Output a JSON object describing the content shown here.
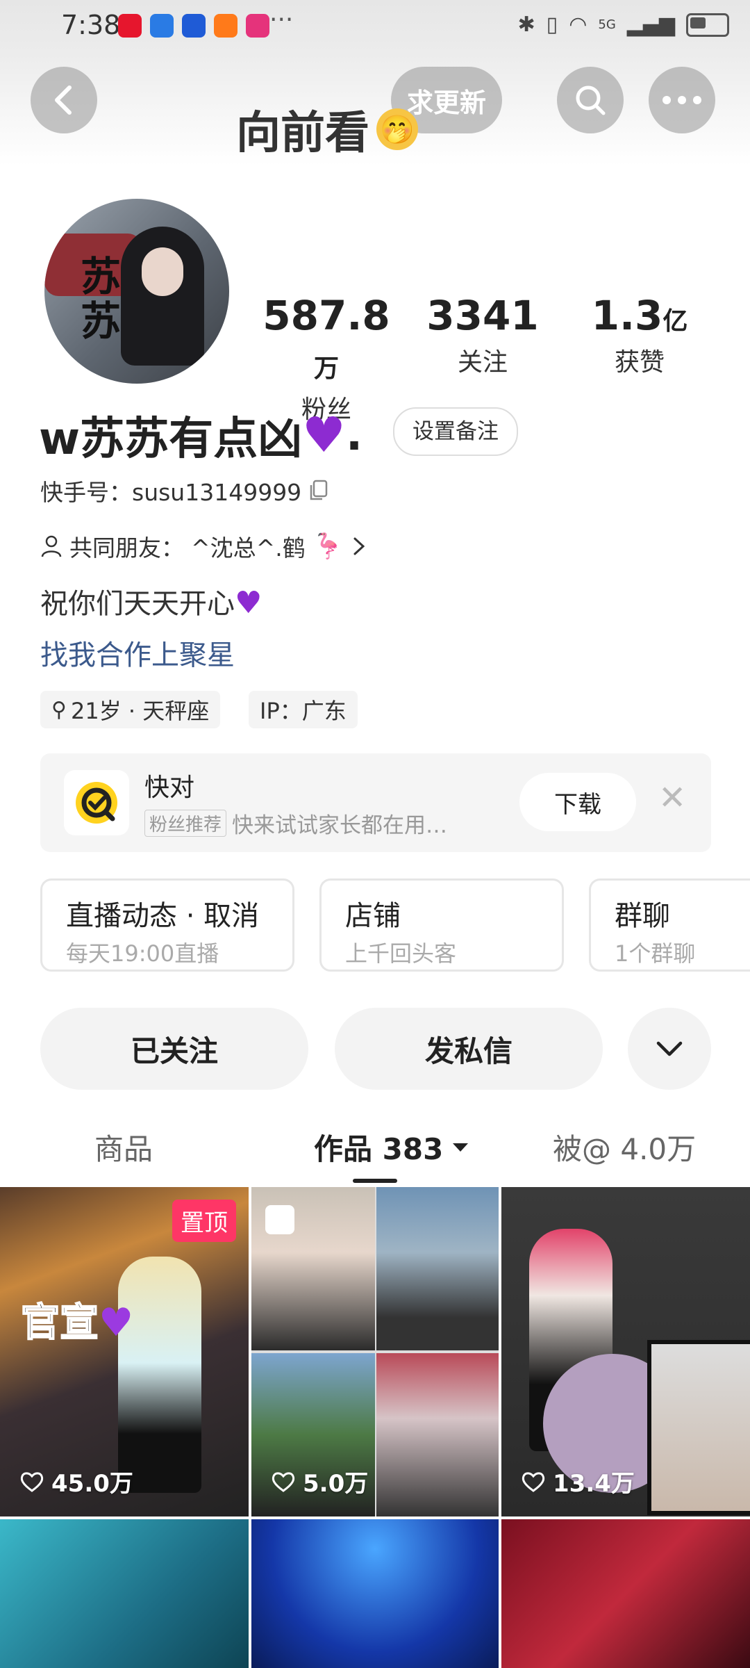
{
  "status_bar": {
    "time": "7:38",
    "more": "···",
    "network": "5G"
  },
  "header": {
    "title": "向前看",
    "update_label": "求更新"
  },
  "profile": {
    "name": "w苏苏有点凶",
    "name_suffix": ".",
    "avatar_text": "苏苏",
    "remark_label": "设置备注",
    "kuaishou_id": "快手号：susu13149999",
    "mutual_friends_label": "共同朋友：",
    "mutual_friends_value": "^沈总^.鹤",
    "bio": "祝你们天天开心",
    "link": "找我合作上聚星",
    "tags": [
      "21岁 · 天秤座",
      "IP：广东"
    ]
  },
  "stats": [
    {
      "value": "587.8",
      "unit": "万",
      "label": "粉丝"
    },
    {
      "value": "3341",
      "unit": "",
      "label": "关注"
    },
    {
      "value": "1.3",
      "unit": "亿",
      "label": "获赞"
    }
  ],
  "ad": {
    "title": "快对",
    "badge": "粉丝推荐",
    "subtitle": "快来试试家长都在用…",
    "download_label": "下载"
  },
  "features": [
    {
      "title": "直播动态 · 取消",
      "subtitle": "每天19:00直播"
    },
    {
      "title": "店铺",
      "subtitle": "上千回头客"
    },
    {
      "title": "群聊",
      "subtitle": "1个群聊"
    }
  ],
  "actions": {
    "follow": "已关注",
    "message": "发私信"
  },
  "tabs": [
    {
      "label": "商品"
    },
    {
      "label": "作品 383"
    },
    {
      "label": "被@ 4.0万"
    }
  ],
  "posts": [
    {
      "likes": "45.0万",
      "pinned": "置顶",
      "overlay": "官宣"
    },
    {
      "likes": "5.0万"
    },
    {
      "likes": "13.4万"
    }
  ],
  "colors": {
    "accent": "#fe3666",
    "link": "#3c5a8c",
    "heart": "#8d2bd1"
  }
}
